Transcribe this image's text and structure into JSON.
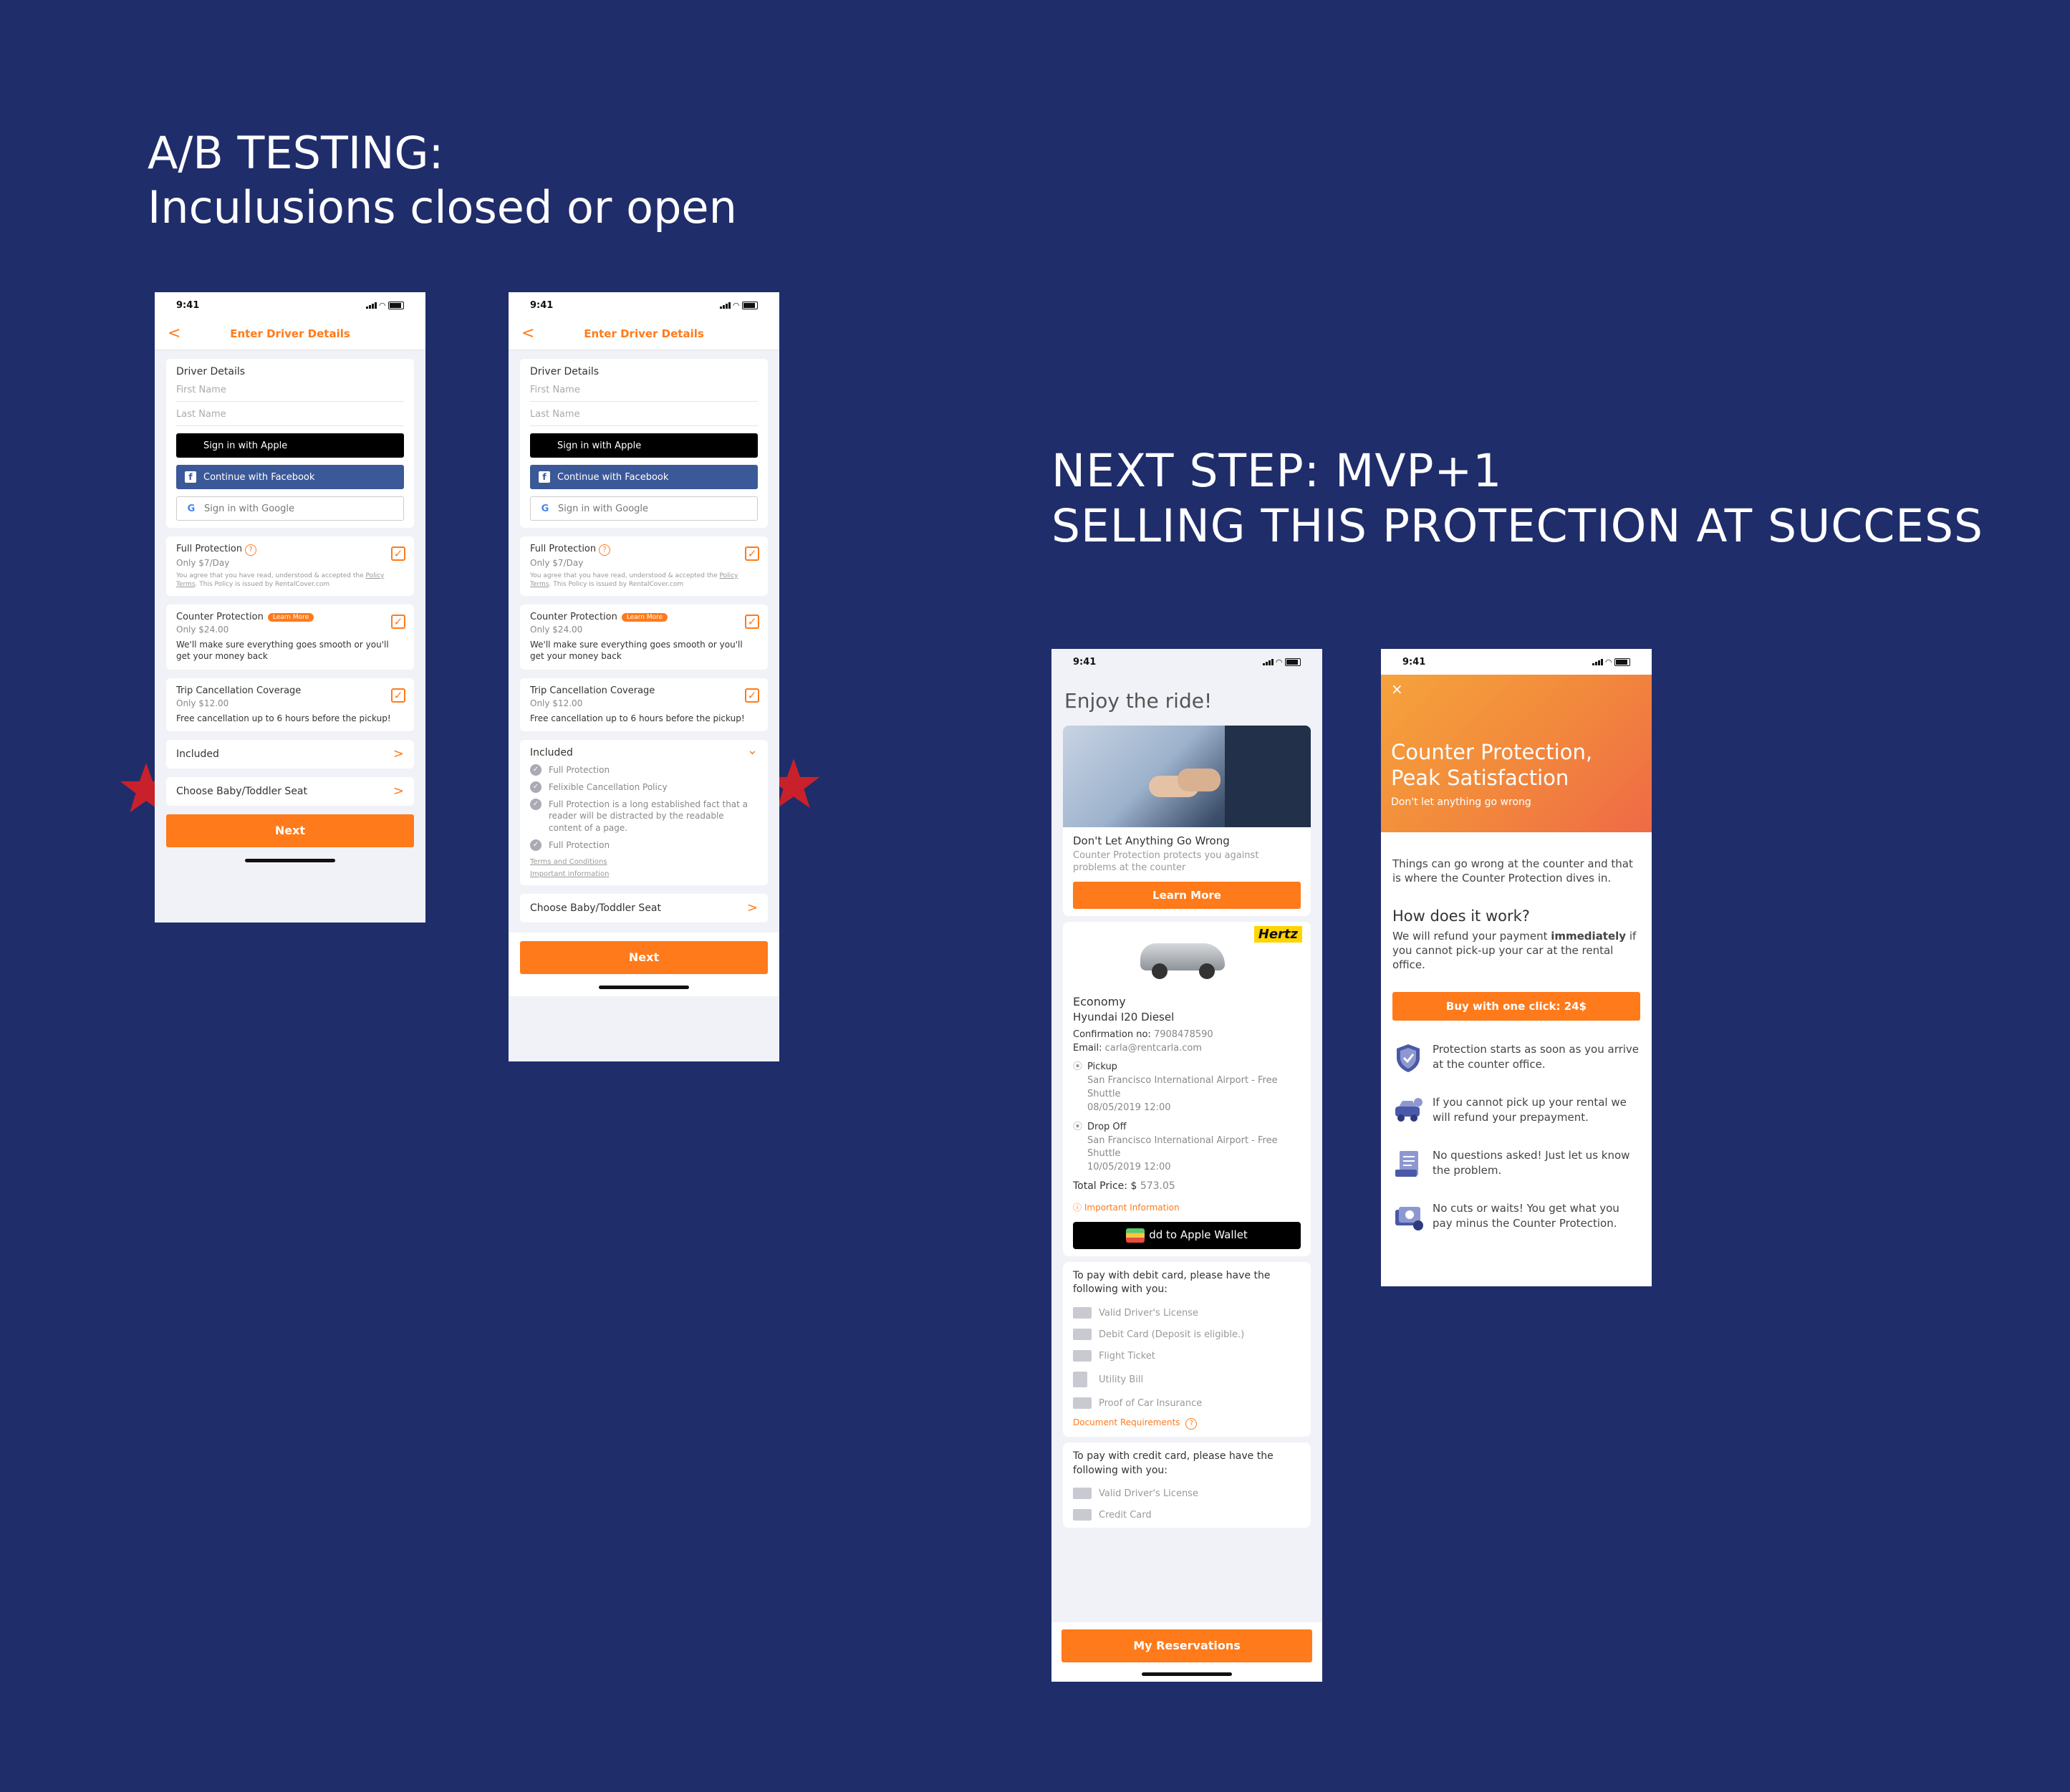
{
  "headings": {
    "ab_line1": "A/B TESTING:",
    "ab_line2": "Inculusions closed or open",
    "next_line1": "NEXT STEP: MVP+1",
    "next_line2": "SELLING THIS PROTECTION AT SUCCESS"
  },
  "colors": {
    "background": "#1f2d6b",
    "accent": "#ff7a1a",
    "star": "#c8212b"
  },
  "phone1": {
    "time": "9:41",
    "back": "<",
    "title": "Enter Driver Details",
    "driver_label": "Driver Details",
    "first_name_placeholder": "First Name",
    "last_name_placeholder": "Last Name",
    "apple_icon": "",
    "apple": "Sign in with Apple",
    "facebook_icon": "f",
    "facebook": "Continue with Facebook",
    "google_icon": "G",
    "google": "Sign in with Google",
    "full_protection": "Full Protection",
    "qmark": "?",
    "full_price": "Only $7/Day",
    "terms_pre": "You agree that you have read, understood & accepted the ",
    "terms_link": "Policy Terms",
    "terms_post": ". This Policy is issued by RentalCover.com",
    "counter": "Counter Protection",
    "learn_more": "Learn More",
    "counter_price": "Only $24.00",
    "counter_desc": "We'll make sure everything goes smooth or you'll get your money back",
    "trip": "Trip Cancellation Coverage",
    "trip_price": "Only $12.00",
    "trip_desc": "Free cancellation up to 6 hours before the pickup!",
    "check": "✓",
    "included": "Included",
    "chev_right": ">",
    "baby_seat": "Choose Baby/Toddler Seat",
    "next": "Next"
  },
  "phone2": {
    "time": "9:41",
    "back": "<",
    "title": "Enter Driver Details",
    "driver_label": "Driver Details",
    "first_name_placeholder": "First Name",
    "last_name_placeholder": "Last Name",
    "apple_icon": "",
    "apple": "Sign in with Apple",
    "facebook_icon": "f",
    "facebook": "Continue with Facebook",
    "google_icon": "G",
    "google": "Sign in with Google",
    "full_protection": "Full Protection",
    "qmark": "?",
    "full_price": "Only $7/Day",
    "terms_pre": "You agree that you have read, understood & accepted the ",
    "terms_link": "Policy Terms",
    "terms_post": ". This Policy is issued by RentalCover.com",
    "counter": "Counter Protection",
    "learn_more": "Learn More",
    "counter_price": "Only $24.00",
    "counter_desc": "We'll make sure everything goes smooth or you'll get your money back",
    "trip": "Trip Cancellation Coverage",
    "trip_price": "Only $12.00",
    "trip_desc": "Free cancellation up to 6 hours before the pickup!",
    "check": "✓",
    "included": "Included",
    "chev_down": "⌄",
    "chev_right": ">",
    "inc_items": [
      "Full Protection",
      "Felixible Cancellation Policy",
      "Full Protection is a long established fact that a reader will be distracted by the readable content of a page.",
      "Full Protection"
    ],
    "terms_conditions": "Terms and Conditions",
    "important_info": "Important information",
    "baby_seat": "Choose Baby/Toddler Seat",
    "next": "Next"
  },
  "phone3": {
    "time": "9:41",
    "greeting": "Enjoy the ride!",
    "promo_title": "Don't Let Anything Go Wrong",
    "promo_desc": "Counter Protection protects you against problems at the counter",
    "learn_more": "Learn More",
    "brand": "Hertz",
    "car_class": "Economy",
    "car_model": "Hyundai I20 Diesel",
    "conf_label": "Confirmation no:",
    "conf_value": "7908478590",
    "email_label": "Email:",
    "email_value": "carla@rentcarla.com",
    "pin": "⦿",
    "pickup_label": "Pickup",
    "pickup_place": "San Francisco International Airport - Free Shuttle",
    "pickup_date": "08/05/2019   12:00",
    "dropoff_label": "Drop Off",
    "dropoff_place": "San Francisco International Airport - Free Shuttle",
    "dropoff_date": "10/05/2019   12:00",
    "total_label": "Total Price: $",
    "total_value": "573.05",
    "important_icon": "ⓘ",
    "important": "Important Information",
    "wallet": "dd to Apple Wallet",
    "debit_intro": "To pay with debit card, please have the following with you:",
    "debit_docs": [
      "Valid Driver's License",
      "Debit Card (Deposit is eligible.)",
      "Flight Ticket",
      "Utility Bill",
      "Proof of Car Insurance"
    ],
    "doc_req": "Document Requirements",
    "qmark": "?",
    "credit_intro": "To pay with credit card, please have the following with you:",
    "credit_docs": [
      "Valid Driver's License",
      "Credit Card"
    ],
    "my_reservations": "My Reservations"
  },
  "phone4": {
    "time": "9:41",
    "close": "×",
    "hero_title_1": "Counter Protection,",
    "hero_title_2": "Peak Satisfaction",
    "hero_sub": "Don't let anything go wrong",
    "intro": "Things can go wrong at the counter and that is where the Counter Protection dives in.",
    "how_title": "How does it work?",
    "how_pre": "We will refund your payment ",
    "how_bold": "immediately",
    "how_post": " if you cannot pick-up your car at the rental office.",
    "buy": "Buy with one click: 24$",
    "features": [
      {
        "icon": "shield-icon",
        "text": "Protection starts as soon as you arrive at the counter office."
      },
      {
        "icon": "car-refund-icon",
        "text": "If you cannot pick up your rental we will refund your prepayment."
      },
      {
        "icon": "document-icon",
        "text": "No questions asked! Just let us know the problem."
      },
      {
        "icon": "money-icon",
        "text": "No cuts or waits! You get what you pay minus the Counter Protection."
      }
    ]
  }
}
